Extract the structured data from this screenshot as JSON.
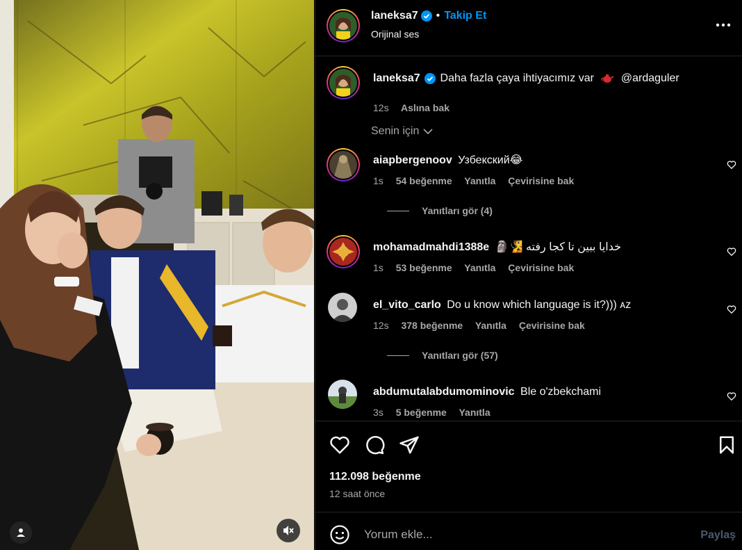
{
  "post": {
    "author": "laneksa7",
    "follow_label": "Takip Et",
    "separator": "•",
    "audio": "Orijinal ses",
    "more_label": "•••"
  },
  "caption": {
    "author": "laneksa7",
    "text": "Daha fazla çaya ihtiyacımız var",
    "mention": "@ardaguler",
    "time": "12s",
    "translate": "Aslına bak"
  },
  "filter": {
    "label": "Senin için"
  },
  "comments": [
    {
      "author": "aiapbergenoov",
      "text": "Узбекский😂",
      "time": "1s",
      "likes": "54 beğenme",
      "reply": "Yanıtla",
      "translate": "Çevirisine bak",
      "replies": "Yanıtları gör (4)"
    },
    {
      "author": "mohamadmahdi1388e",
      "text": "🗿🧏 خدایا ببین تا کجا رفته",
      "time": "1s",
      "likes": "53 beğenme",
      "reply": "Yanıtla",
      "translate": "Çevirisine bak"
    },
    {
      "author": "el_vito_carlo",
      "text": "Do u know which language is it?))) ᴀᴢ",
      "time": "12s",
      "likes": "378 beğenme",
      "reply": "Yanıtla",
      "translate": "Çevirisine bak",
      "replies": "Yanıtları gör (57)"
    },
    {
      "author": "abdumutalabdumominovic",
      "text": "Ble o'zbekchami",
      "time": "3s",
      "likes": "5 beğenme",
      "reply": "Yanıtla"
    }
  ],
  "stats": {
    "likes": "112.098 beğenme",
    "posted": "12 saat önce"
  },
  "composer": {
    "placeholder": "Yorum ekle...",
    "share": "Paylaş"
  },
  "colors": {
    "accent": "#0095f6",
    "verified": "#0095f6",
    "muted": "#a8a8a8",
    "divider": "#262626"
  },
  "icons": [
    "verified-icon",
    "more-icon",
    "chevron-down-icon",
    "heart-icon",
    "comment-icon",
    "share-icon",
    "bookmark-icon",
    "emoji-icon",
    "user-tag-icon",
    "mute-icon"
  ]
}
